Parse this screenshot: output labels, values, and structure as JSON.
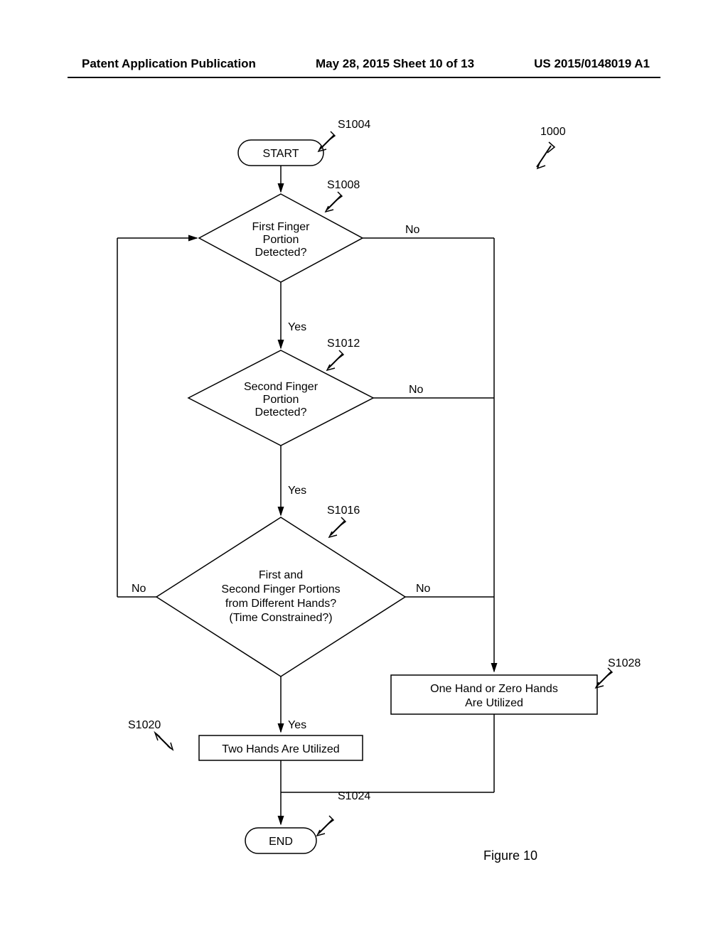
{
  "header": {
    "left": "Patent Application Publication",
    "center": "May 28, 2015  Sheet 10 of 13",
    "right": "US 2015/0148019 A1"
  },
  "flowchart": {
    "ref_overall": "1000",
    "start": {
      "label": "START",
      "ref": "S1004"
    },
    "d1": {
      "line1": "First Finger",
      "line2": "Portion",
      "line3": "Detected?",
      "ref": "S1008",
      "yes": "Yes",
      "no": "No"
    },
    "d2": {
      "line1": "Second Finger",
      "line2": "Portion",
      "line3": "Detected?",
      "ref": "S1012",
      "yes": "Yes",
      "no": "No"
    },
    "d3": {
      "line1": "First and",
      "line2": "Second Finger Portions",
      "line3": "from Different Hands?",
      "line4": "(Time Constrained?)",
      "ref": "S1016",
      "yes": "Yes",
      "no_left": "No",
      "no_right": "No"
    },
    "box1": {
      "text": "Two Hands Are Utilized",
      "ref": "S1020"
    },
    "box2": {
      "line1": "One Hand or Zero Hands",
      "line2": "Are Utilized",
      "ref": "S1028"
    },
    "end": {
      "label": "END",
      "ref": "S1024"
    }
  },
  "caption": "Figure 10"
}
